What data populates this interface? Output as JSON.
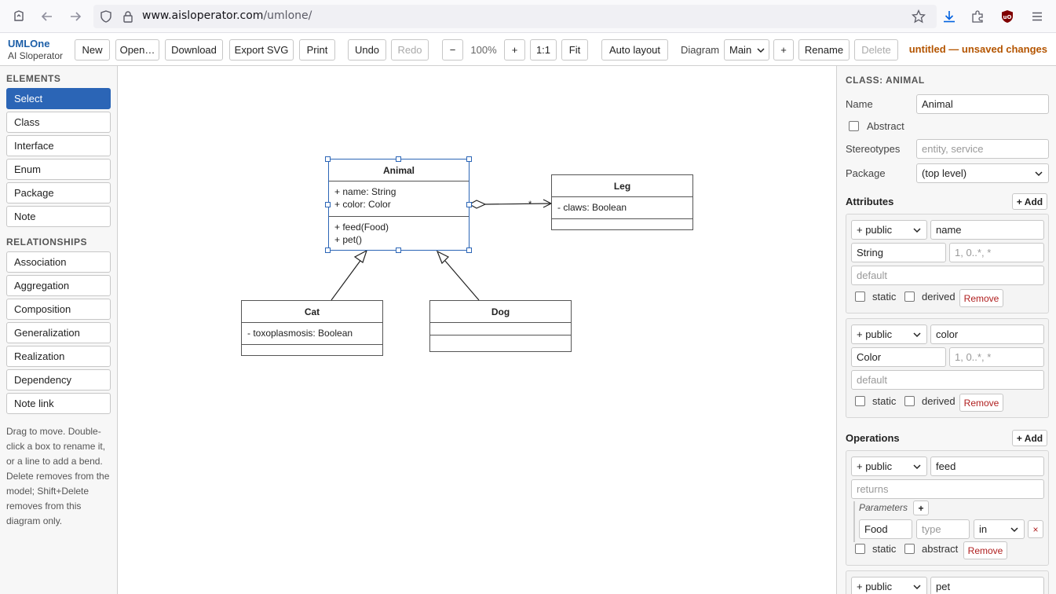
{
  "browser": {
    "url_host": "www.aisloperator.com",
    "url_path": "/umlone/"
  },
  "app": {
    "brand_name": "UMLOne",
    "brand_sub": "AI Sloperator",
    "toolbar": {
      "new": "New",
      "open": "Open…",
      "download": "Download",
      "export_svg": "Export SVG",
      "print": "Print",
      "undo": "Undo",
      "redo": "Redo",
      "zoom_out": "−",
      "zoom_level": "100%",
      "zoom_in": "+",
      "zoom_reset": "1:1",
      "fit": "Fit",
      "auto_layout": "Auto layout",
      "diagram_label": "Diagram",
      "diagram_value": "Main",
      "add_diagram": "+",
      "rename": "Rename",
      "delete": "Delete",
      "status": "untitled — unsaved changes"
    }
  },
  "sidebar": {
    "elements_heading": "ELEMENTS",
    "elements": [
      "Select",
      "Class",
      "Interface",
      "Enum",
      "Package",
      "Note"
    ],
    "relationships_heading": "RELATIONSHIPS",
    "relationships": [
      "Association",
      "Aggregation",
      "Composition",
      "Generalization",
      "Realization",
      "Dependency",
      "Note link"
    ],
    "help": "Drag to move. Double-click a box to rename it, or a line to add a bend. Delete removes from the model; Shift+Delete removes from this diagram only."
  },
  "diagram": {
    "classes": {
      "animal": {
        "name": "Animal",
        "attributes": [
          "+ name: String",
          "+ color: Color"
        ],
        "operations": [
          "+ feed(Food)",
          "+ pet()"
        ]
      },
      "leg": {
        "name": "Leg",
        "attributes": [
          "- claws: Boolean"
        ],
        "operations": []
      },
      "cat": {
        "name": "Cat",
        "attributes": [
          "- toxoplasmosis: Boolean"
        ],
        "operations": []
      },
      "dog": {
        "name": "Dog",
        "attributes": [],
        "operations": []
      }
    },
    "aggregation_multiplicity": "*"
  },
  "inspector": {
    "heading": "CLASS: ANIMAL",
    "name_label": "Name",
    "name_value": "Animal",
    "abstract_label": "Abstract",
    "stereotypes_label": "Stereotypes",
    "stereotypes_placeholder": "entity, service",
    "package_label": "Package",
    "package_value": "(top level)",
    "attributes_heading": "Attributes",
    "add_label": "+ Add",
    "attributes": [
      {
        "visibility": "+ public",
        "name": "name",
        "type": "String",
        "multiplicity_ph": "1, 0..*, *",
        "default_ph": "default",
        "static": "static",
        "derived": "derived",
        "remove": "Remove"
      },
      {
        "visibility": "+ public",
        "name": "color",
        "type": "Color",
        "multiplicity_ph": "1, 0..*, *",
        "default_ph": "default",
        "static": "static",
        "derived": "derived",
        "remove": "Remove"
      }
    ],
    "operations_heading": "Operations",
    "operations": [
      {
        "visibility": "+ public",
        "name": "feed",
        "returns_ph": "returns",
        "params_label": "Parameters",
        "param_add": "+",
        "param_name": "Food",
        "param_type_ph": "type",
        "param_dir": "in",
        "param_remove": "×",
        "static": "static",
        "abstract": "abstract",
        "remove": "Remove"
      },
      {
        "visibility": "+ public",
        "name": "pet"
      }
    ]
  }
}
